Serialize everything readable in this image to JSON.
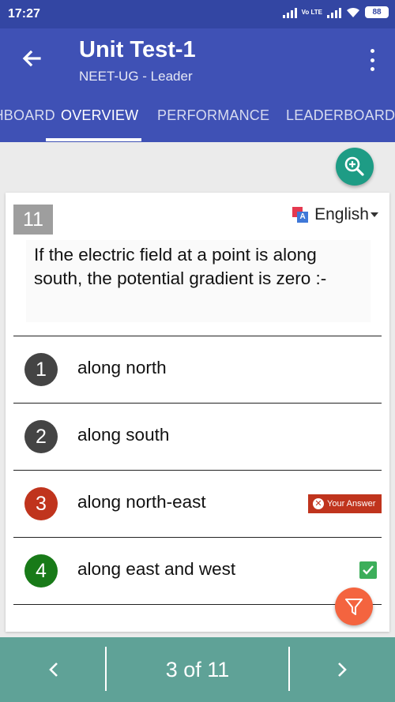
{
  "status_bar": {
    "time": "17:27",
    "battery": "88",
    "network": "Vo LTE"
  },
  "header": {
    "title": "Unit Test-1",
    "subtitle": "NEET-UG - Leader"
  },
  "tabs": [
    {
      "label": "DASHBOARD",
      "active": false
    },
    {
      "label": "OVERVIEW",
      "active": true
    },
    {
      "label": "PERFORMANCE",
      "active": false
    },
    {
      "label": "LEADERBOARD",
      "active": false
    }
  ],
  "question": {
    "number": "11",
    "language": "English",
    "text": "If the electric field at a point is along south, the potential gradient is zero :-"
  },
  "options": [
    {
      "num": "1",
      "label": "along north",
      "color": "#444444",
      "status": "none"
    },
    {
      "num": "2",
      "label": "along south",
      "color": "#444444",
      "status": "none"
    },
    {
      "num": "3",
      "label": "along north-east",
      "color": "#c0341d",
      "status": "your_answer"
    },
    {
      "num": "4",
      "label": "along east and west",
      "color": "#187a18",
      "status": "correct"
    }
  ],
  "your_answer_label": "Your Answer",
  "pagination": {
    "text": "3 of 11"
  },
  "colors": {
    "primary": "#3f51b5",
    "status_bar": "#3346a3",
    "accent_teal": "#1e9c85",
    "bottom_bar": "#5fa297",
    "filter_fab": "#f4643f"
  },
  "icons": {
    "back": "arrow-left-icon",
    "menu": "more-vert-icon",
    "zoom": "zoom-in-icon",
    "language": "translate-icon",
    "filter": "filter-icon",
    "prev": "chevron-left-icon",
    "next": "chevron-right-icon"
  }
}
